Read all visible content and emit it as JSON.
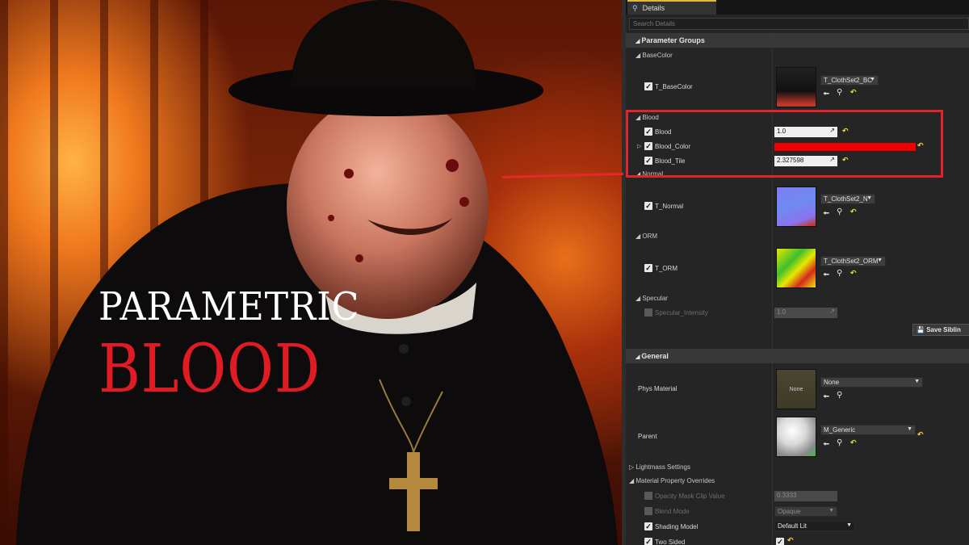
{
  "overlay": {
    "title_line1": "PARAMETRIC",
    "title_line2": "BLOOD",
    "highlight_color": "#e1242b"
  },
  "panel": {
    "tab_label": "Details",
    "tab_icon": "magnifier-icon",
    "search_placeholder": "Search Details",
    "parameter_groups": {
      "header": "Parameter Groups",
      "basecolor": {
        "group": "BaseColor",
        "label": "T_BaseColor",
        "texture": "T_ClothSet2_BC"
      },
      "blood": {
        "group": "Blood",
        "blood_label": "Blood",
        "blood_value": "1.0",
        "color_label": "Blood_Color",
        "color_value": "#ee0000",
        "tile_label": "Blood_Tile",
        "tile_value": "2.327598"
      },
      "normal": {
        "group": "Normal",
        "label": "T_Normal",
        "texture": "T_ClothSet2_N"
      },
      "orm": {
        "group": "ORM",
        "label": "T_ORM",
        "texture": "T_ClothSet2_ORM"
      },
      "specular": {
        "group": "Specular",
        "label": "Specular_Intensity",
        "value": "1.0"
      },
      "save_button": "Save Siblin"
    },
    "general": {
      "header": "General",
      "phys_material_label": "Phys Material",
      "phys_material_thumb": "None",
      "phys_material_value": "None",
      "parent_label": "Parent",
      "parent_value": "M_Generic",
      "lightmass": "Lightmass Settings",
      "overrides": "Material Property Overrides",
      "opacity_label": "Opacity Mask Clip Value",
      "opacity_value": "0.3333",
      "blend_label": "Blend Mode",
      "blend_value": "Opaque",
      "shading_label": "Shading Model",
      "shading_value": "Default Lit",
      "twosided_label": "Two Sided"
    }
  }
}
